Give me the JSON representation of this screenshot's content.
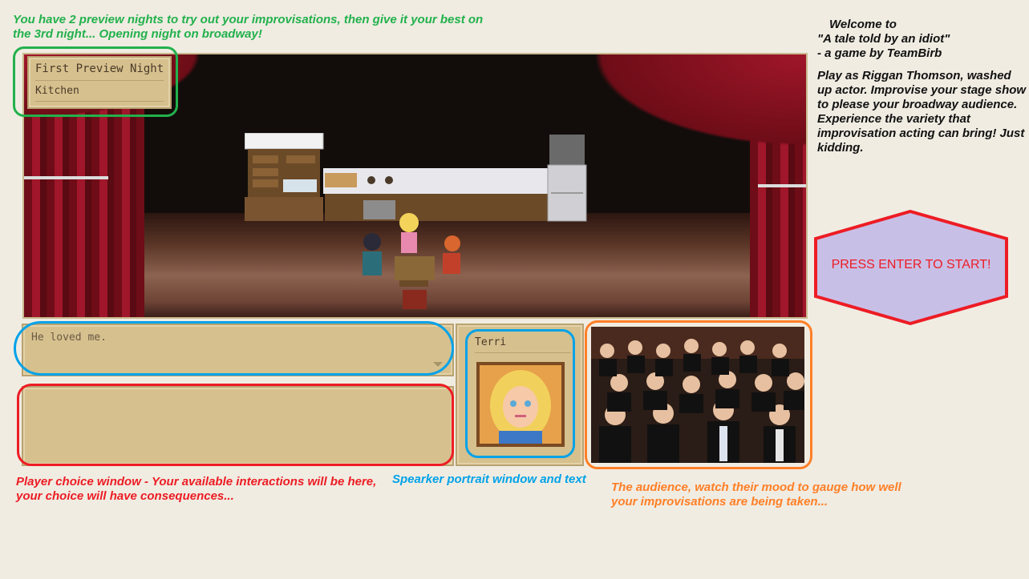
{
  "notes": {
    "top_green": "You have 2 preview nights to try out your improvisations, then give it your best on the 3rd night... Opening night on broadway!",
    "welcome_line1": "Welcome to",
    "welcome_line2": "\"A tale told by an idiot\"",
    "welcome_line3": " - a game by TeamBirb",
    "description": "Play as Riggan Thomson, washed up actor. Improvise your stage show to please your broadway audience. Experience the variety that improvisation acting can bring! Just kidding.",
    "player_choice": "Player choice window - Your available interactions will be here, your choice will have consequences...",
    "speaker": "Spearker portrait window and text",
    "audience": "The audience, watch their mood to gauge how well your improvisations are being taken..."
  },
  "location_panel": {
    "night": "First Preview Night",
    "scene": "Kitchen"
  },
  "dialogue": {
    "text": "He loved me."
  },
  "speaker": {
    "name": "Terri"
  },
  "start_button": {
    "label": "PRESS ENTER TO START!"
  },
  "colors": {
    "green": "#22b14c",
    "red": "#ed1c24",
    "blue": "#00a2e8",
    "orange": "#ff7f27",
    "hexagon_fill": "#c8bfe7",
    "panel": "#d6c08e"
  }
}
